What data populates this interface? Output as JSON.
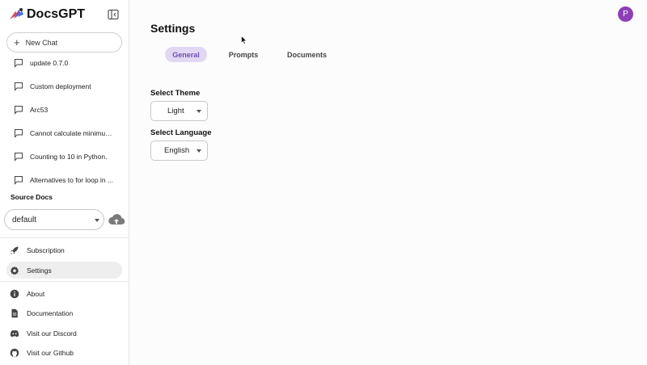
{
  "app": {
    "name": "DocsGPT"
  },
  "sidebar": {
    "new_chat_label": "New Chat",
    "conversations": [
      "update 0.7.0",
      "Custom deployment",
      "Arc53",
      "Cannot calculate minimum ...",
      "Counting to 10 in Python.",
      "Alternatives to for loop in ..."
    ],
    "source_docs": {
      "title": "Source Docs",
      "selected": "default"
    },
    "nav_primary": [
      {
        "label": "Subscription",
        "icon": "rocket-icon"
      },
      {
        "label": "Settings",
        "icon": "gear-icon",
        "active": true
      }
    ],
    "nav_secondary": [
      {
        "label": "About",
        "icon": "info-icon"
      },
      {
        "label": "Documentation",
        "icon": "document-icon"
      },
      {
        "label": "Visit our Discord",
        "icon": "discord-icon"
      },
      {
        "label": "Visit our Github",
        "icon": "github-icon"
      }
    ]
  },
  "header": {
    "avatar_initial": "P"
  },
  "settings": {
    "title": "Settings",
    "tabs": [
      {
        "label": "General",
        "active": true
      },
      {
        "label": "Prompts",
        "active": false
      },
      {
        "label": "Documents",
        "active": false
      }
    ],
    "theme": {
      "label": "Select Theme",
      "value": "Light"
    },
    "language": {
      "label": "Select Language",
      "value": "English"
    }
  },
  "colors": {
    "accent": "#8e3fb5",
    "tab_active_bg": "#e2d8f4",
    "tab_active_text": "#6d4fb0"
  }
}
